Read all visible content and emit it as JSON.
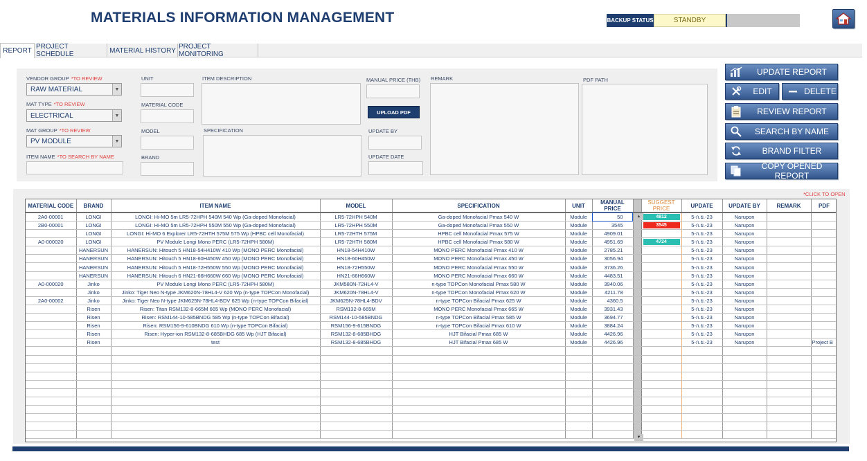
{
  "header": {
    "title": "MATERIALS INFORMATION MANAGEMENT",
    "backup_label": "BACKUP STATUS",
    "backup_value": "STANDBY"
  },
  "tabs": [
    "REPORT",
    "PROJECT SCHEDULE",
    "MATERIAL HISTORY",
    "PROJECT MONITORING"
  ],
  "form": {
    "vendor_group_label": "VENDOR GROUP",
    "vendor_group_req": "*TO REVIEW",
    "vendor_group_value": "RAW MATERIAL",
    "mat_type_label": "MAT TYPE",
    "mat_type_req": "*TO REVIEW",
    "mat_type_value": "ELECTRICAL",
    "mat_group_label": "MAT GROUP",
    "mat_group_req": "*TO REVIEW",
    "mat_group_value": "PV MODULE",
    "item_name_label": "ITEM NAME",
    "item_name_req": "*TO SEARCH BY NAME",
    "unit_label": "UNIT",
    "material_code_label": "MATERIAL CODE",
    "model_label": "MODEL",
    "brand_label": "BRAND",
    "item_description_label": "ITEM DESCRIPTION",
    "specification_label": "SPECIFICATION",
    "manual_price_label": "MANUAL PRICE",
    "manual_price_unit": "(THB)",
    "upload_pdf": "UPLOAD PDF",
    "update_by_label": "UPDATE BY",
    "update_date_label": "UPDATE DATE",
    "remark_label": "REMARK",
    "pdf_path_label": "PDF PATH"
  },
  "actions": {
    "update_report": "UPDATE REPORT",
    "edit": "EDIT",
    "delete": "DELETE",
    "review_report": "REVIEW REPORT",
    "search_by_name": "SEARCH BY NAME",
    "brand_filter": "BRAND FILTER",
    "copy_opened_report": "COPY OPENED REPORT"
  },
  "table": {
    "click_to_open": "*CLICK TO OPEN",
    "columns": [
      "MATERIAL CODE",
      "BRAND",
      "ITEM NAME",
      "MODEL",
      "SPECIFICATION",
      "UNIT",
      "MANUAL PRICE",
      "",
      "SUGGEST PRICE",
      "UPDATE",
      "UPDATE BY",
      "REMARK",
      "PDF"
    ],
    "rows": [
      {
        "code": "2A0-00001",
        "brand": "LONGI",
        "item": "LONGI: Hi-MO 5m LR5-72HPH 540M 540 Wp (Ga-doped  Monofacial)",
        "model": "LR5-72HPH 540M",
        "spec": "Ga-doped  Monofacial  Pmax 540 W",
        "unit": "Module",
        "price": "50",
        "suggest": "4812",
        "suggest_color": "#2bbfb3",
        "update": "5-ก.ย.-23",
        "by": "Narupon",
        "remark": "",
        "pdf": ""
      },
      {
        "code": "2B0-00001",
        "brand": "LONGI",
        "item": "LONGI: Hi-MO 5m LR5-72HPH 550M 550 Wp (Ga-doped  Monofacial)",
        "model": "LR5-72HPH 550M",
        "spec": "Ga-doped  Monofacial  Pmax 550 W",
        "unit": "Module",
        "price": "3545",
        "suggest": "3545",
        "suggest_color": "#ee2a1e",
        "update": "5-ก.ย.-23",
        "by": "Narupon",
        "remark": "",
        "pdf": ""
      },
      {
        "code": "",
        "brand": "LONGI",
        "item": "LONGI: Hi-MO 6 Explorer LR5-72HTH 575M 575 Wp (HPBC cell Monofacial)",
        "model": "LR5-72HTH 575M",
        "spec": "HPBC cell  Monofacial  Pmax 575 W",
        "unit": "Module",
        "price": "4909.01",
        "suggest": "",
        "suggest_color": "",
        "update": "5-ก.ย.-23",
        "by": "Narupon",
        "remark": "",
        "pdf": ""
      },
      {
        "code": "A0-000020",
        "brand": "LONGI",
        "item": "PV Module Longi Mono PERC (LR5-72HPH 580M)",
        "model": "LR5-72HTH 580M",
        "spec": "HPBC cell  Monofacial  Pmax 580 W",
        "unit": "Module",
        "price": "4951.69",
        "suggest": "4724",
        "suggest_color": "#2bbfb3",
        "update": "5-ก.ย.-23",
        "by": "Narupon",
        "remark": "",
        "pdf": ""
      },
      {
        "code": "",
        "brand": "HANERSUN",
        "item": "HANERSUN: Hitouch 5 HN18-54H410W 410 Wp (MONO PERC  Monofacial)",
        "model": "HN18-54H410W",
        "spec": "MONO PERC  Monofacial  Pmax 410 W",
        "unit": "Module",
        "price": "2785.21",
        "suggest": "",
        "suggest_color": "",
        "update": "5-ก.ย.-23",
        "by": "Narupon",
        "remark": "",
        "pdf": ""
      },
      {
        "code": "",
        "brand": "HANERSUN",
        "item": "HANERSUN: Hitouch 5 HN18-60H450W 450 Wp (MONO PERC  Monofacial)",
        "model": "HN18-60H450W",
        "spec": "MONO PERC  Monofacial  Pmax 450 W",
        "unit": "Module",
        "price": "3056.94",
        "suggest": "",
        "suggest_color": "",
        "update": "5-ก.ย.-23",
        "by": "Narupon",
        "remark": "",
        "pdf": ""
      },
      {
        "code": "",
        "brand": "HANERSUN",
        "item": "HANERSUN: Hitouch 5 HN18-72H550W 550 Wp (MONO PERC  Monofacial)",
        "model": "HN18-72H550W",
        "spec": "MONO PERC  Monofacial  Pmax 550 W",
        "unit": "Module",
        "price": "3736.26",
        "suggest": "",
        "suggest_color": "",
        "update": "5-ก.ย.-23",
        "by": "Narupon",
        "remark": "",
        "pdf": ""
      },
      {
        "code": "",
        "brand": "HANERSUN",
        "item": "HANERSUN: Hitouch 6 HN21-66H660W 660 Wp (MONO PERC  Monofacial)",
        "model": "HN21-66H660W",
        "spec": "MONO PERC  Monofacial  Pmax 660 W",
        "unit": "Module",
        "price": "4483.51",
        "suggest": "",
        "suggest_color": "",
        "update": "5-ก.ย.-23",
        "by": "Narupon",
        "remark": "",
        "pdf": ""
      },
      {
        "code": "A0-000020",
        "brand": "Jinko",
        "item": "PV Module Longi Mono PERC (LR5-72HPH 580M)",
        "model": "JKM580N-72HL4-V",
        "spec": "n-type TOPCon Monofacial  Pmax 580 W",
        "unit": "Module",
        "price": "3940.06",
        "suggest": "",
        "suggest_color": "",
        "update": "5-ก.ย.-23",
        "by": "Narupon",
        "remark": "",
        "pdf": ""
      },
      {
        "code": "",
        "brand": "Jinko",
        "item": "Jinko: Tiger Neo N-type JKM620N-78HL4-V 620 Wp (n-type TOPCon  Monofacial)",
        "model": "JKM620N-78HL4-V",
        "spec": "n-type TOPCon Monofacial  Pmax 620 W",
        "unit": "Module",
        "price": "4211.78",
        "suggest": "",
        "suggest_color": "",
        "update": "5-ก.ย.-23",
        "by": "Narupon",
        "remark": "",
        "pdf": ""
      },
      {
        "code": "2A0-00002",
        "brand": "Jinko",
        "item": "Jinko: Tiger Neo N-type JKM625N-78HL4-BDV 625 Wp (n-type TOPCon  Bifacial)",
        "model": "JKM625N-78HL4-BDV",
        "spec": "n-type TOPCon Bifacial  Pmax 625 W",
        "unit": "Module",
        "price": "4360.5",
        "suggest": "",
        "suggest_color": "",
        "update": "5-ก.ย.-23",
        "by": "Narupon",
        "remark": "",
        "pdf": ""
      },
      {
        "code": "",
        "brand": "Risen",
        "item": "Risen: Titan RSM132-8-665M 665 Wp (MONO PERC  Monofacial)",
        "model": "RSM132-8-665M",
        "spec": "MONO PERC  Monofacial  Pmax 665 W",
        "unit": "Module",
        "price": "3931.43",
        "suggest": "",
        "suggest_color": "",
        "update": "5-ก.ย.-23",
        "by": "Narupon",
        "remark": "",
        "pdf": ""
      },
      {
        "code": "",
        "brand": "Risen",
        "item": "Risen: RSM144-10-585BNDG 585 Wp (n-type TOPCon  Bifacial)",
        "model": "RSM144-10-585BNDG",
        "spec": "n-type TOPCon Bifacial  Pmax 585 W",
        "unit": "Module",
        "price": "3694.77",
        "suggest": "",
        "suggest_color": "",
        "update": "5-ก.ย.-23",
        "by": "Narupon",
        "remark": "",
        "pdf": ""
      },
      {
        "code": "",
        "brand": "Risen",
        "item": "Risen: RSM156-9-610BNDG 610 Wp (n-type TOPCon  Bifacial)",
        "model": "RSM156-9-615BNDG",
        "spec": "n-type TOPCon Bifacial  Pmax 610 W",
        "unit": "Module",
        "price": "3884.24",
        "suggest": "",
        "suggest_color": "",
        "update": "5-ก.ย.-23",
        "by": "Narupon",
        "remark": "",
        "pdf": ""
      },
      {
        "code": "",
        "brand": "Risen",
        "item": "Risen: Hyper-ion RSM132-8-685BHDG 685 Wp (HJT  Bifacial)",
        "model": "RSM132-8-685BHDG",
        "spec": "HJT Bifacial  Pmax 685 W",
        "unit": "Module",
        "price": "4426.96",
        "suggest": "",
        "suggest_color": "",
        "update": "5-ก.ย.-23",
        "by": "Narupon",
        "remark": "",
        "pdf": ""
      },
      {
        "code": "",
        "brand": "Risen",
        "item": "test",
        "model": "RSM132-8-685BHDG",
        "spec": "HJT Bifacial  Pmax 685 W",
        "unit": "Module",
        "price": "4426.96",
        "suggest": "",
        "suggest_color": "",
        "update": "5-ก.ย.-23",
        "by": "Narupon",
        "remark": "",
        "pdf": "Project B"
      }
    ],
    "empty_rows": 11
  }
}
